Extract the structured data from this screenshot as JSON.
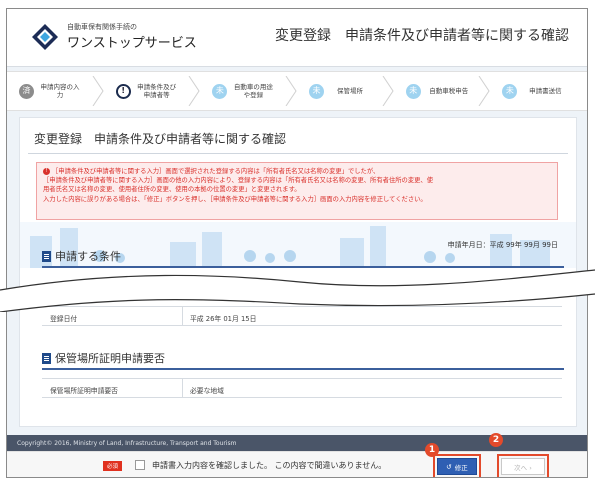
{
  "header": {
    "brand_small": "自動車保有関係手続の",
    "brand_big": "ワンストップサービス",
    "page_heading": "変更登録　申請条件及び申請者等に関する確認"
  },
  "steps": [
    {
      "num": "済",
      "label": "申請内容の入力",
      "state": "done"
    },
    {
      "num": "!",
      "label": "申請条件及び申請者等",
      "state": "current"
    },
    {
      "num": "未",
      "label": "自動車の用途や登録",
      "state": "todo"
    },
    {
      "num": "未",
      "label": "保管場所",
      "state": "todo"
    },
    {
      "num": "未",
      "label": "自動車税申告",
      "state": "todo"
    },
    {
      "num": "未",
      "label": "申請書送信",
      "state": "todo"
    }
  ],
  "content": {
    "title": "変更登録　申請条件及び申請者等に関する確認",
    "alert_lines": [
      "［申請条件及び申請者等に関する入力］画面で選択された登録する内容は「所有者氏名又は名称の変更」でしたが、",
      "［申請条件及び申請者等に関する入力］画面の他の入力内容により、登録する内容は「所有者氏名又は名称の変更、所有者住所の変更、使",
      "用者氏名又は名称の変更、使用者住所の変更、使用の本拠の位置の変更」と変更されます。",
      "入力した内容に誤りがある場合は、「修正」ボタンを押し、［申請条件及び申請者等に関する入力］画面の入力内容を修正してください。"
    ],
    "date_label": "申請年月日：平成 99年 99月 99日",
    "section1_title": "申請する条件",
    "section1_rows": [
      {
        "key": "登録日付",
        "value": "平成 26年 01月 15日"
      }
    ],
    "section2_title": "保管場所証明申請要否",
    "section2_rows": [
      {
        "key": "保管場所証明申請要否",
        "value": "必要な地域"
      }
    ]
  },
  "footer": {
    "copyright": "Copyright© 2016, Ministry of Land, Infrastructure, Transport and Tourism"
  },
  "bottombar": {
    "required_badge": "必須",
    "confirm_label": "申請書入力内容を確認しました。 この内容で間違いありません。",
    "fix_button": "修正",
    "next_button": "次へ ›"
  },
  "callouts": [
    "1",
    "2"
  ],
  "colors": {
    "accent": "#1f4a8a",
    "alert": "#d9302b",
    "callout": "#e34a2b"
  }
}
